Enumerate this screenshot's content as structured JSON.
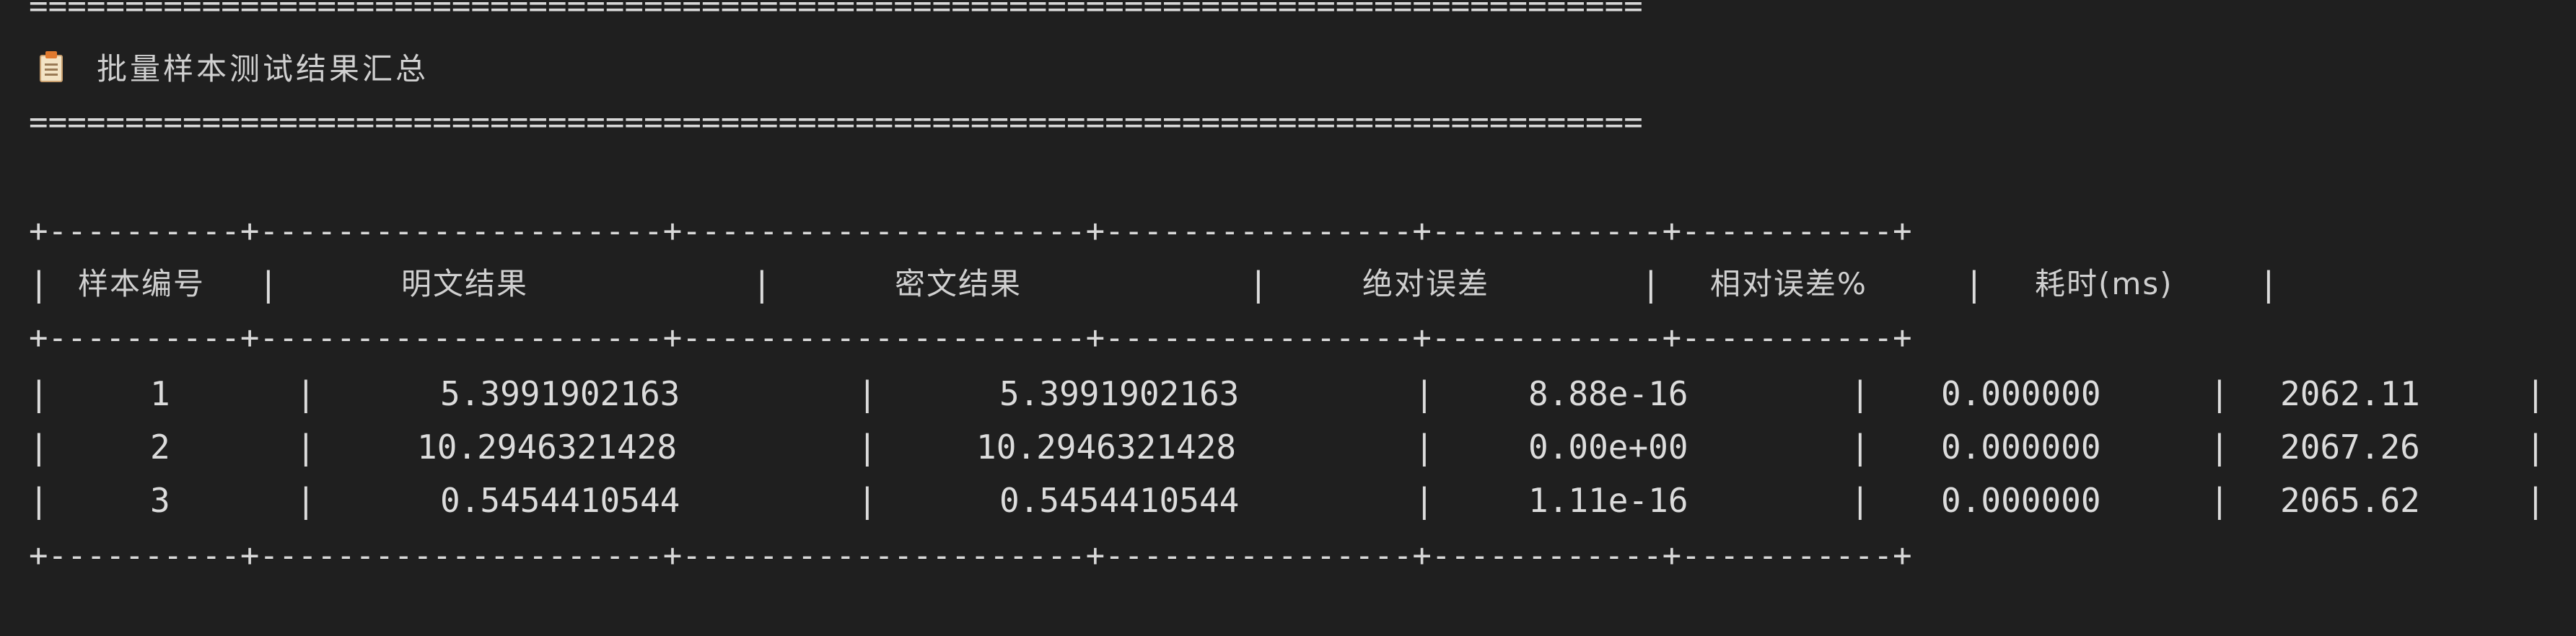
{
  "terminal": {
    "separator": "====================================================================================",
    "title_icon": "memo-icon",
    "title": "批量样本测试结果汇总",
    "border_line": "+----------+---------------------+---------------------+----------------+------------+-----------+"
  },
  "table": {
    "headers": [
      "样本编号",
      "明文结果",
      "密文结果",
      "绝对误差",
      "相对误差%",
      "耗时(ms)"
    ],
    "rows": [
      [
        "1",
        "5.3991902163",
        "5.3991902163",
        "8.88e-16",
        "0.000000",
        "2062.11"
      ],
      [
        "2",
        "10.2946321428",
        "10.2946321428",
        "0.00e+00",
        "0.000000",
        "2067.26"
      ],
      [
        "3",
        "0.5454410544",
        "0.5454410544",
        "1.11e-16",
        "0.000000",
        "2065.62"
      ]
    ]
  }
}
